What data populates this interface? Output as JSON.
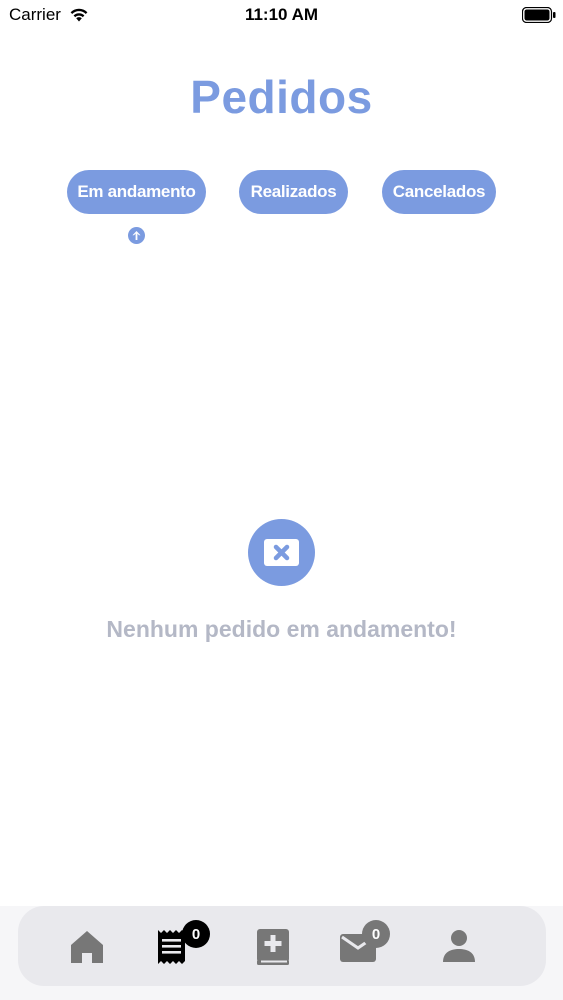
{
  "status_bar": {
    "carrier": "Carrier",
    "time": "11:10 AM"
  },
  "header": {
    "title": "Pedidos"
  },
  "tabs": [
    {
      "label": "Em andamento",
      "active": true
    },
    {
      "label": "Realizados",
      "active": false
    },
    {
      "label": "Cancelados",
      "active": false
    }
  ],
  "empty_state": {
    "icon": "close-box-icon",
    "message": "Nenhum pedido em andamento!"
  },
  "bottom_nav": {
    "items": [
      {
        "icon": "home-icon",
        "active": false
      },
      {
        "icon": "receipt-icon",
        "active": true,
        "badge": "0"
      },
      {
        "icon": "medical-book-icon",
        "active": false
      },
      {
        "icon": "mail-icon",
        "active": false,
        "badge": "0"
      },
      {
        "icon": "user-icon",
        "active": false
      }
    ]
  },
  "colors": {
    "accent": "#7b9be0",
    "empty_text": "#b4b8c6",
    "nav_icon": "#777777",
    "nav_icon_active": "#000000",
    "nav_background": "#e9e9ed"
  }
}
